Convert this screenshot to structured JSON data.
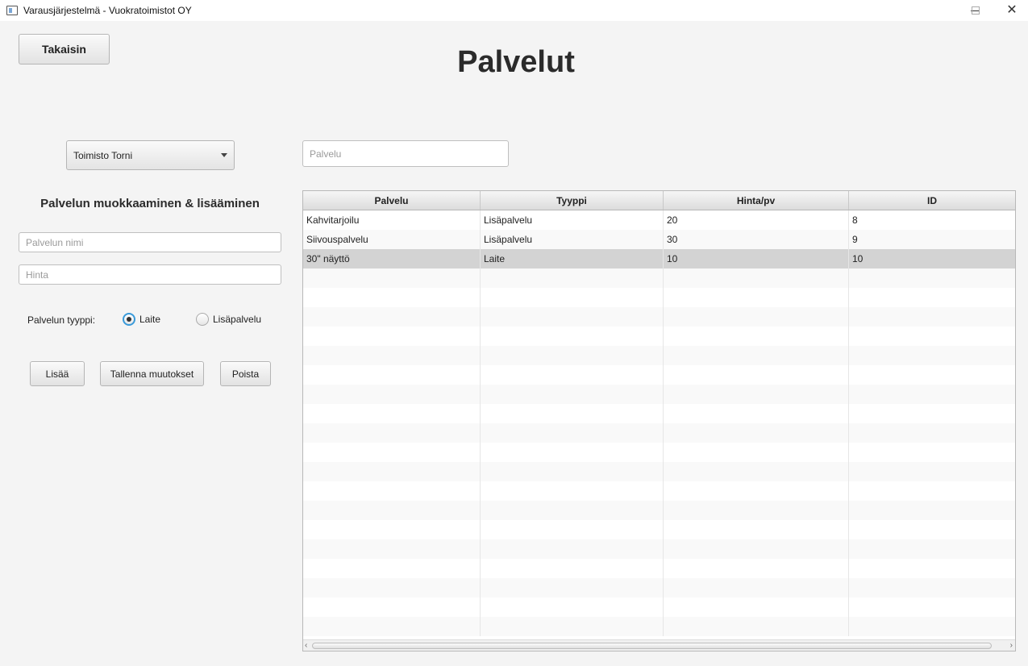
{
  "window": {
    "title": "Varausjärjestelmä - Vuokratoimistot OY",
    "controls": {
      "minimize": "—",
      "maximize": "☐",
      "close": "✕"
    }
  },
  "header": {
    "back_label": "Takaisin",
    "page_title": "Palvelut"
  },
  "office_select": {
    "value": "Toimisto Torni"
  },
  "search": {
    "placeholder": "Palvelu"
  },
  "editor": {
    "title": "Palvelun muokkaaminen & lisääminen",
    "name_placeholder": "Palvelun nimi",
    "price_placeholder": "Hinta",
    "type_label": "Palvelun tyyppi:",
    "type_options": [
      "Laite",
      "Lisäpalvelu"
    ],
    "type_selected": "Laite",
    "add_label": "Lisää",
    "save_label": "Tallenna muutokset",
    "delete_label": "Poista"
  },
  "table": {
    "columns": [
      "Palvelu",
      "Tyyppi",
      "Hinta/pv",
      "ID"
    ],
    "rows": [
      [
        "Kahvitarjoilu",
        "Lisäpalvelu",
        "20",
        "8"
      ],
      [
        "Siivouspalvelu",
        "Lisäpalvelu",
        "30",
        "9"
      ],
      [
        "30\" näyttö",
        "Laite",
        "10",
        "10"
      ]
    ],
    "selected_row": 2
  }
}
